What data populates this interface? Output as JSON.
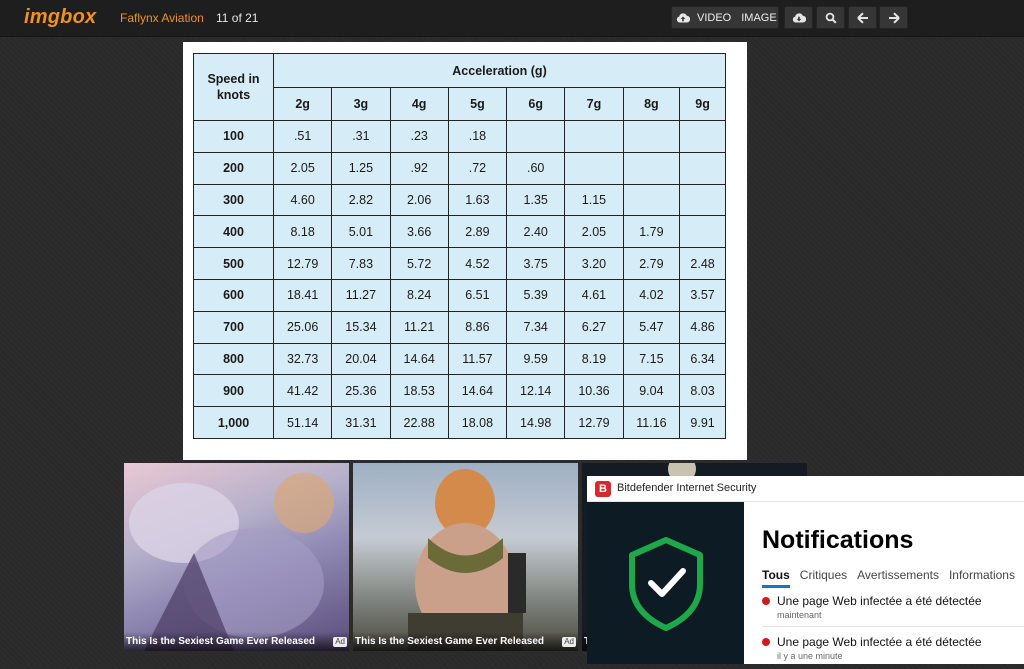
{
  "topbar": {
    "logo": "imgbox",
    "gallery_title": "Faflynx Aviation",
    "counter": "11 of 21",
    "buttons": {
      "video_label": "VIDEO",
      "image_label": "IMAGE"
    },
    "icons": {
      "upload_video": "cloud-upload-icon",
      "upload_image": "cloud-upload-icon",
      "download": "cloud-download-icon",
      "search": "search-icon",
      "prev": "arrow-left-icon",
      "next": "arrow-right-icon"
    },
    "accent_color": "#f0921d"
  },
  "main_image": {
    "table": {
      "speed_header": "Speed in knots",
      "group_header": "Acceleration (g)",
      "accel_columns": [
        "2g",
        "3g",
        "4g",
        "5g",
        "6g",
        "7g",
        "8g",
        "9g"
      ],
      "rows": [
        {
          "speed": "100",
          "values": [
            ".51",
            ".31",
            ".23",
            ".18",
            "",
            "",
            "",
            ""
          ]
        },
        {
          "speed": "200",
          "values": [
            "2.05",
            "1.25",
            ".92",
            ".72",
            ".60",
            "",
            "",
            ""
          ]
        },
        {
          "speed": "300",
          "values": [
            "4.60",
            "2.82",
            "2.06",
            "1.63",
            "1.35",
            "1.15",
            "",
            ""
          ]
        },
        {
          "speed": "400",
          "values": [
            "8.18",
            "5.01",
            "3.66",
            "2.89",
            "2.40",
            "2.05",
            "1.79",
            ""
          ]
        },
        {
          "speed": "500",
          "values": [
            "12.79",
            "7.83",
            "5.72",
            "4.52",
            "3.75",
            "3.20",
            "2.79",
            "2.48"
          ]
        },
        {
          "speed": "600",
          "values": [
            "18.41",
            "11.27",
            "8.24",
            "6.51",
            "5.39",
            "4.61",
            "4.02",
            "3.57"
          ]
        },
        {
          "speed": "700",
          "values": [
            "25.06",
            "15.34",
            "11.21",
            "8.86",
            "7.34",
            "6.27",
            "5.47",
            "4.86"
          ]
        },
        {
          "speed": "800",
          "values": [
            "32.73",
            "20.04",
            "14.64",
            "11.57",
            "9.59",
            "8.19",
            "7.15",
            "6.34"
          ]
        },
        {
          "speed": "900",
          "values": [
            "41.42",
            "25.36",
            "18.53",
            "14.64",
            "12.14",
            "10.36",
            "9.04",
            "8.03"
          ]
        },
        {
          "speed": "1,000",
          "values": [
            "51.14",
            "31.31",
            "22.88",
            "18.08",
            "14.98",
            "12.79",
            "11.16",
            "9.91"
          ]
        }
      ],
      "cell_color": "#d6edf8"
    }
  },
  "ads": [
    {
      "caption": "This Is the Sexiest Game Ever Released",
      "badge": "Ad"
    },
    {
      "caption": "This Is the Sexiest Game Ever Released",
      "badge": "Ad"
    },
    {
      "caption": "T",
      "badge": ""
    }
  ],
  "bitdefender": {
    "app_name": "Bitdefender Internet Security",
    "logo_letter": "B",
    "heading": "Notifications",
    "tabs": [
      "Tous",
      "Critiques",
      "Avertissements",
      "Informations"
    ],
    "active_tab": "Tous",
    "notifications": [
      {
        "text": "Une page Web infectée a été détectée",
        "time": "maintenant"
      },
      {
        "text": "Une page Web infectée a été détectée",
        "time": "il y a une minute"
      }
    ],
    "shield_icon": "shield-check-icon",
    "shield_color": "#1fa84a"
  }
}
